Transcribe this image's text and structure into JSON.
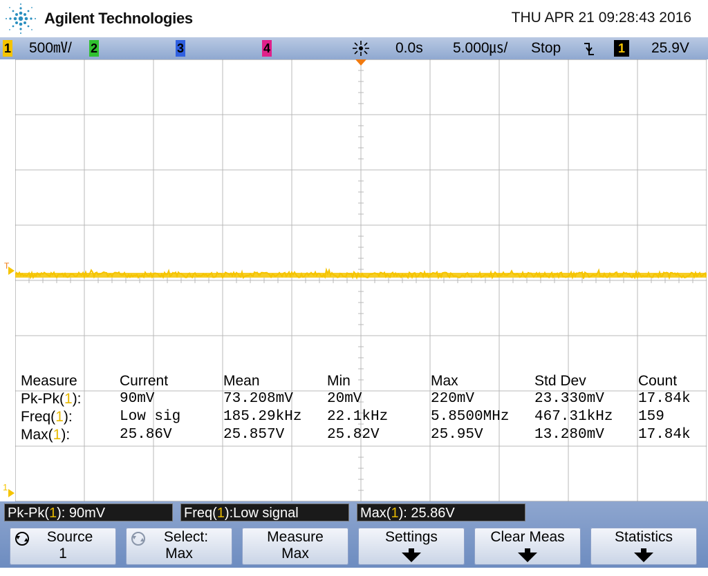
{
  "header": {
    "brand": "Agilent Technologies",
    "datetime": "THU APR 21 09:28:43 2016"
  },
  "status": {
    "ch1_label": "1",
    "ch1_scale": "500㎷/",
    "ch2_label": "2",
    "ch3_label": "3",
    "ch4_label": "4",
    "time_delay": "0.0s",
    "time_scale": "5.000㎲/",
    "run_state": "Stop",
    "trigger_slope_icon": "falling-edge-icon",
    "trigger_source": "1",
    "trigger_level": "25.9V"
  },
  "colors": {
    "ch1": "#f5c400",
    "ch2": "#30c030",
    "ch3": "#3060e0",
    "ch4": "#e0208a",
    "trigger_marker": "#f07a10"
  },
  "markers": {
    "trigger_level_marker": "T",
    "ch1_ground_marker": "1"
  },
  "measurements": {
    "headers": [
      "Measure",
      "Current",
      "Mean",
      "Min",
      "Max",
      "Std Dev",
      "Count"
    ],
    "rows": [
      {
        "name_pre": "Pk-Pk(",
        "ch": "1",
        "name_post": "):",
        "current": "90mV",
        "mean": "73.208mV",
        "min": "20mV",
        "max": "220mV",
        "std": "23.330mV",
        "count": "17.84k"
      },
      {
        "name_pre": "Freq(",
        "ch": "1",
        "name_post": "):",
        "current": "Low sig",
        "mean": "185.29kHz",
        "min": "22.1kHz",
        "max": "5.8500MHz",
        "std": "467.31kHz",
        "count": "159"
      },
      {
        "name_pre": "Max(",
        "ch": "1",
        "name_post": "):",
        "current": "25.86V",
        "mean": "25.857V",
        "min": "25.82V",
        "max": "25.95V",
        "std": "13.280mV",
        "count": "17.84k"
      }
    ]
  },
  "readouts": [
    {
      "pre": "Pk-Pk(",
      "ch": "1",
      "post": "): 90mV"
    },
    {
      "pre": "Freq(",
      "ch": "1",
      "post": "):Low signal"
    },
    {
      "pre": "Max(",
      "ch": "1",
      "post": "): 25.86V"
    }
  ],
  "softkeys": [
    {
      "line1": "Source",
      "line2": "1",
      "icon": "rotate-knob-icon",
      "has_arrow": false
    },
    {
      "line1": "Select:",
      "line2": "Max",
      "icon": "rotate-knob-icon",
      "has_arrow": false
    },
    {
      "line1": "Measure",
      "line2": "Max",
      "icon": "",
      "has_arrow": false
    },
    {
      "line1": "Settings",
      "line2": "",
      "icon": "down-arrow-icon",
      "has_arrow": true
    },
    {
      "line1": "Clear Meas",
      "line2": "",
      "icon": "down-arrow-icon",
      "has_arrow": true
    },
    {
      "line1": "Statistics",
      "line2": "",
      "icon": "down-arrow-icon",
      "has_arrow": true
    }
  ]
}
